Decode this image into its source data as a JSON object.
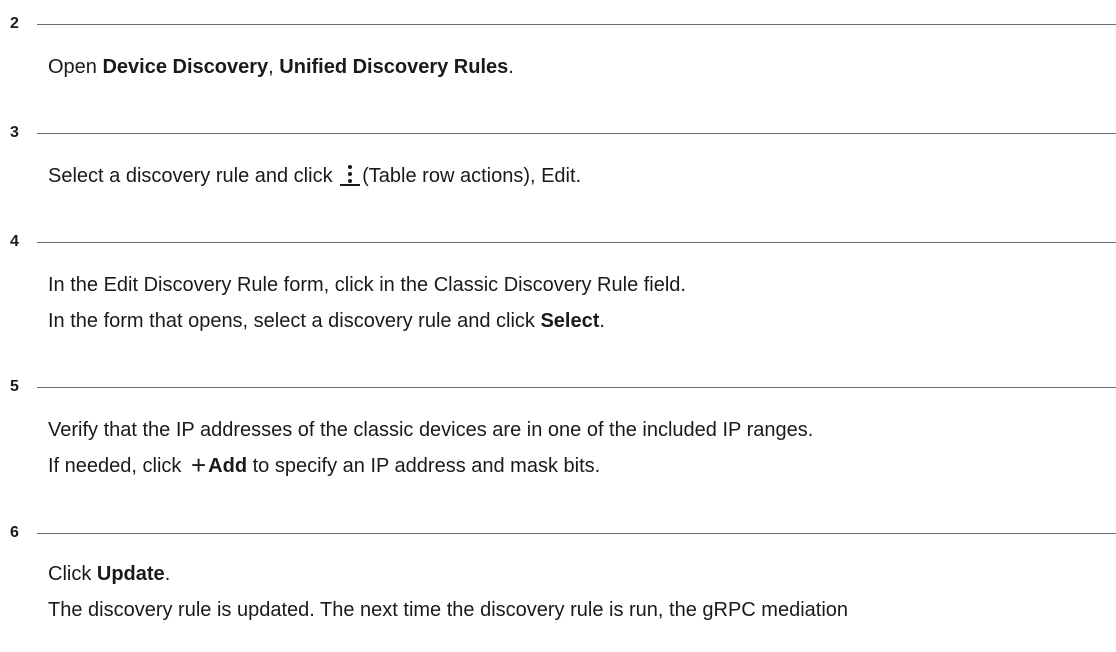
{
  "steps": [
    {
      "number": "2",
      "lines": [
        {
          "p1": "Open ",
          "b1": "Device Discovery",
          "p2": ", ",
          "b2": "Unified Discovery Rules",
          "p3": "."
        }
      ]
    },
    {
      "number": "3",
      "lines": [
        {
          "p1": "Select a discovery rule and click ",
          "icon": "kebab-icon",
          "p2": "(Table row actions), Edit."
        }
      ]
    },
    {
      "number": "4",
      "lines": [
        {
          "p1": "In the Edit Discovery Rule form, click in the Classic Discovery Rule field."
        },
        {
          "p1": "In the form that opens, select a discovery rule and click ",
          "b1": "Select",
          "p2": "."
        }
      ]
    },
    {
      "number": "5",
      "lines": [
        {
          "p1": "Verify that the IP addresses of the classic devices are in one of the included IP ranges."
        },
        {
          "p1": "If needed, click ",
          "icon": "plus-icon",
          "icon_glyph": "+",
          "b1": "Add",
          "p2": " to specify an IP address and mask bits."
        }
      ]
    },
    {
      "number": "6",
      "lines": [
        {
          "p1": "Click ",
          "b1": "Update",
          "p2": "."
        },
        {
          "p1": "The discovery rule is updated. The next time the discovery rule is run, the gRPC mediation"
        }
      ]
    }
  ]
}
